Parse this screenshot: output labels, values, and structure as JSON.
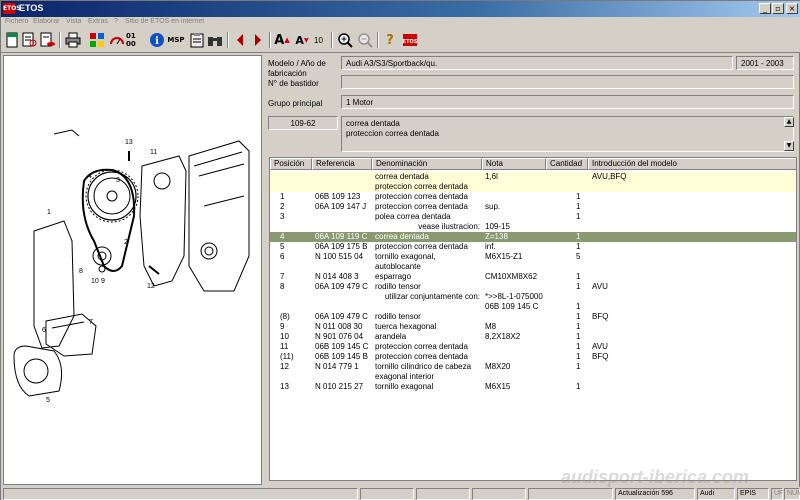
{
  "app": {
    "title": "ETOS",
    "icon_text": "ETOS"
  },
  "menu": [
    "Fichero",
    "Elaborar",
    "Vista",
    "Extras",
    "?",
    "Sitio de ETOS  en internet"
  ],
  "toolbar": {
    "msp_label": "MSP",
    "font_size": "10",
    "nav_label": "01 00"
  },
  "info": {
    "model_label": "Modelo / Año de fabricación",
    "chassis_label": "N° de bastidor",
    "model_value": "Audi A3/S3/Sportback/qu.",
    "year_value": "2001 - 2003",
    "group_label": "Grupo principal",
    "group_value": "1  Motor",
    "part_code": "109-62",
    "desc_line1": "correa dentada",
    "desc_line2": "proteccion correa dentada"
  },
  "table": {
    "columns": [
      "Posición",
      "Referencia",
      "Denominación",
      "Nota",
      "Cantidad",
      "Introducción del modelo"
    ],
    "rows": [
      {
        "pos": "",
        "ref": "",
        "den": "correa dentada",
        "nota": "1,6l",
        "cant": "",
        "intro": "AVU,BFQ",
        "style": "yellow"
      },
      {
        "pos": "",
        "ref": "",
        "den": "proteccion correa dentada",
        "nota": "",
        "cant": "",
        "intro": "",
        "style": "yellow"
      },
      {
        "pos": "1",
        "ref": "06B 109 123",
        "den": "proteccion correa dentada",
        "nota": "",
        "cant": "1",
        "intro": "",
        "style": ""
      },
      {
        "pos": "2",
        "ref": "06A 109 147 J",
        "den": "proteccion correa dentada",
        "nota": "sup.",
        "cant": "1",
        "intro": "",
        "style": ""
      },
      {
        "pos": "3",
        "ref": "",
        "den": "polea correa dentada",
        "nota": "",
        "cant": "1",
        "intro": "",
        "style": ""
      },
      {
        "pos": "",
        "ref": "",
        "den": "vease ilustracion:",
        "nota": "109-15",
        "cant": "",
        "intro": "",
        "style": "right"
      },
      {
        "pos": "4",
        "ref": "06A 109 119 C",
        "den": "correa dentada",
        "nota": "Z=138",
        "cant": "1",
        "intro": "",
        "style": "selected"
      },
      {
        "pos": "5",
        "ref": "06A 109 175 B",
        "den": "proteccion correa dentada",
        "nota": "inf.",
        "cant": "1",
        "intro": "",
        "style": ""
      },
      {
        "pos": "6",
        "ref": "N  100 515 04",
        "den": "tornillo exagonal,",
        "nota": "M6X15-Z1",
        "cant": "5",
        "intro": "",
        "style": ""
      },
      {
        "pos": "",
        "ref": "",
        "den": "autoblocante",
        "nota": "",
        "cant": "",
        "intro": "",
        "style": ""
      },
      {
        "pos": "7",
        "ref": "N  014 408 3",
        "den": "esparrago",
        "nota": "CM10XM8X62",
        "cant": "1",
        "intro": "",
        "style": ""
      },
      {
        "pos": "8",
        "ref": "06A 109 479 C",
        "den": "rodillo tensor",
        "nota": "",
        "cant": "1",
        "intro": "AVU",
        "style": ""
      },
      {
        "pos": "",
        "ref": "",
        "den": "utilizar conjuntamente con:",
        "nota": "*>>8L-1-075000",
        "cant": "",
        "intro": "",
        "style": "right"
      },
      {
        "pos": "",
        "ref": "",
        "den": "",
        "nota": "06B 109 145 C",
        "cant": "1",
        "intro": "",
        "style": ""
      },
      {
        "pos": "(8)",
        "ref": "06A 109 479 C",
        "den": "rodillo tensor",
        "nota": "",
        "cant": "1",
        "intro": "BFQ",
        "style": ""
      },
      {
        "pos": "9",
        "ref": "N  011 008 30",
        "den": "tuerca hexagonal",
        "nota": "M8",
        "cant": "1",
        "intro": "",
        "style": ""
      },
      {
        "pos": "10",
        "ref": "N  901 076 04",
        "den": "arandela",
        "nota": "8,2X18X2",
        "cant": "1",
        "intro": "",
        "style": ""
      },
      {
        "pos": "11",
        "ref": "06B 109 145 C",
        "den": "proteccion correa dentada",
        "nota": "",
        "cant": "1",
        "intro": "AVU",
        "style": ""
      },
      {
        "pos": "(11)",
        "ref": "06B 109 145 B",
        "den": "proteccion correa dentada",
        "nota": "",
        "cant": "1",
        "intro": "BFQ",
        "style": ""
      },
      {
        "pos": "12",
        "ref": "N  014 779 1",
        "den": "tornillo cilindrico de cabeza",
        "nota": "M8X20",
        "cant": "1",
        "intro": "",
        "style": ""
      },
      {
        "pos": "",
        "ref": "",
        "den": "exagonal interior",
        "nota": "",
        "cant": "",
        "intro": "",
        "style": ""
      },
      {
        "pos": "13",
        "ref": "N  010 215 27",
        "den": "tornillo exagonal",
        "nota": "M6X15",
        "cant": "1",
        "intro": "",
        "style": ""
      }
    ]
  },
  "diagram_labels": [
    "13",
    "11",
    "4",
    "3",
    "1",
    "2",
    "10",
    "9",
    "8",
    "12",
    "7",
    "6",
    "5"
  ],
  "watermark": "audisport-iberica.com",
  "status": {
    "update": "Actualización 596",
    "brand": "Audi",
    "epis": "EPIS 209",
    "uf": "UF",
    "num": "NUM"
  },
  "colors": {
    "yellow_row": "#ffffd8",
    "selected_row": "#8a9a70",
    "titlebar": "#0a246a"
  }
}
